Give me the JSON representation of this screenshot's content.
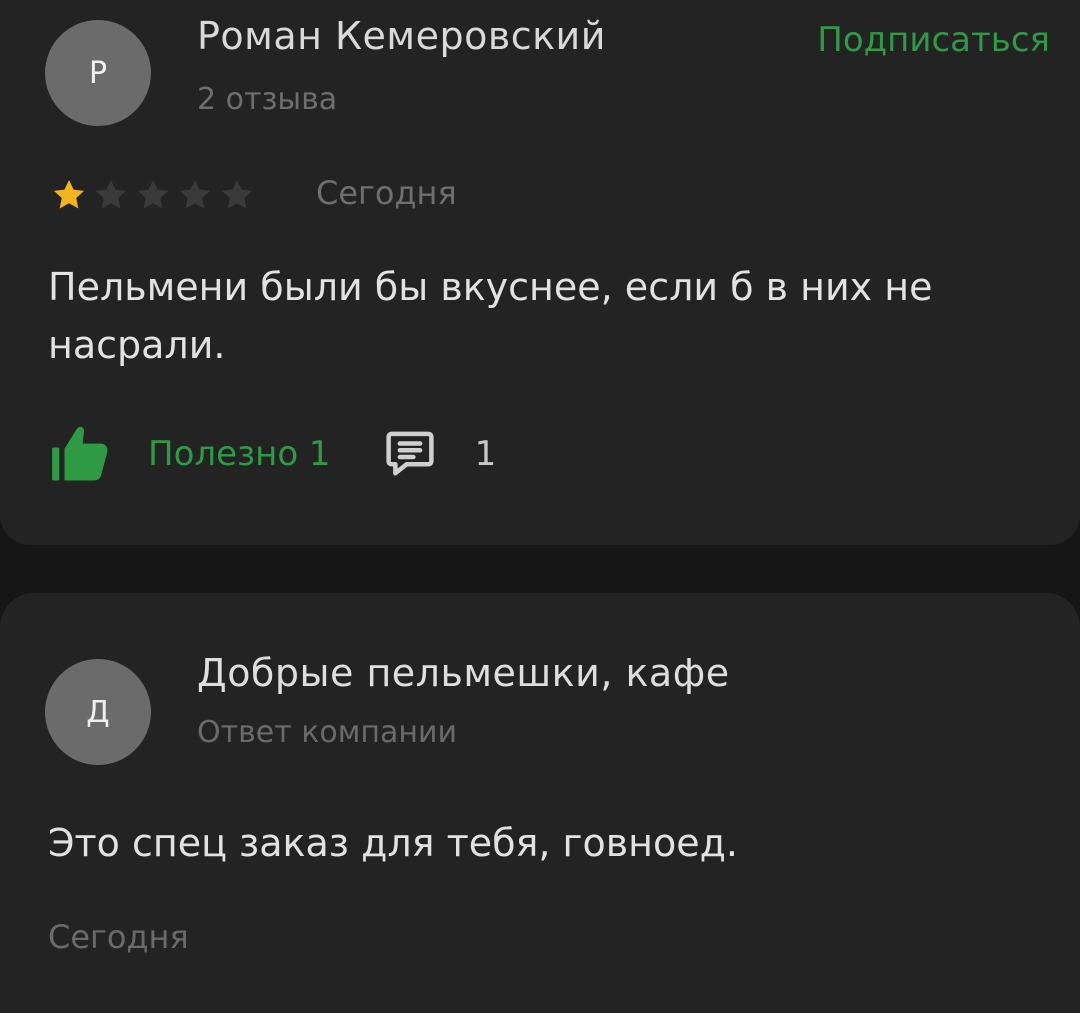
{
  "review": {
    "avatar_letter": "Р",
    "author_name": "Роман Кемеровский",
    "author_reviews": "2 отзыва",
    "subscribe_label": "Подписаться",
    "rating": 1,
    "rating_max": 5,
    "date": "Сегодня",
    "text": "Пельмени были бы вкуснее, если б в них не насрали.",
    "useful_label": "Полезно 1",
    "comment_count": "1",
    "colors": {
      "accent": "#2f9a44",
      "star_active": "#f2b51e",
      "star_inactive": "#3a3a3a"
    }
  },
  "reply": {
    "avatar_letter": "Д",
    "company_name": "Добрые пельмешки, кафе",
    "subtitle": "Ответ компании",
    "text": "Это спец заказ для тебя, говноед.",
    "date": "Сегодня"
  }
}
